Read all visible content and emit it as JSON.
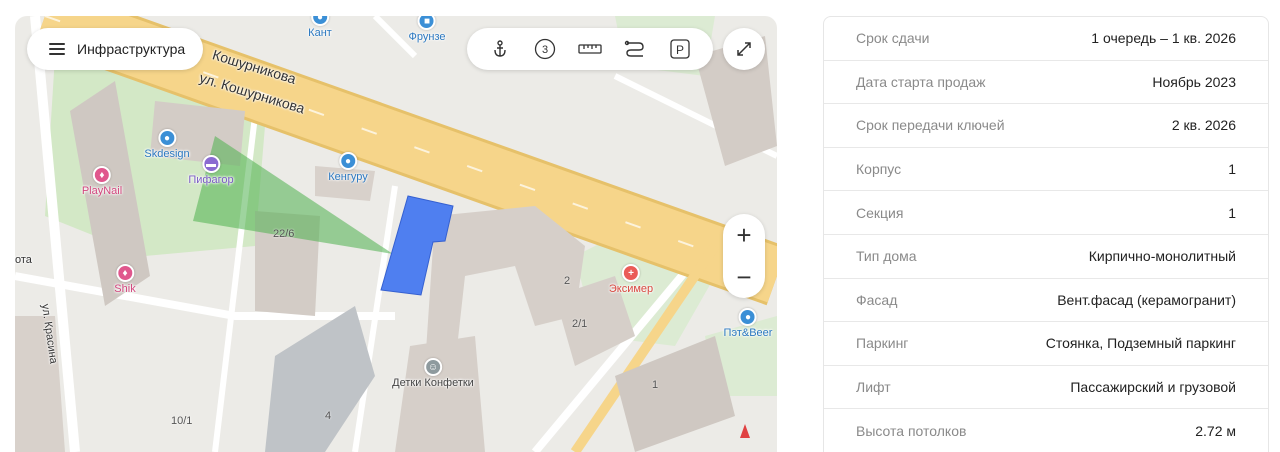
{
  "map": {
    "infra_label": "Инфраструктура",
    "streets": [
      "Кошурникова",
      "ул. Кошурникова",
      "ул. Красина",
      "ота"
    ],
    "pois": [
      {
        "name": "Кант",
        "kind": "blue"
      },
      {
        "name": "Фрунзе",
        "kind": "blue"
      },
      {
        "name": "Skdesign",
        "kind": "blue"
      },
      {
        "name": "Пифагор",
        "kind": "purple"
      },
      {
        "name": "PlayNail",
        "kind": "pink"
      },
      {
        "name": "Кенгуру",
        "kind": "blue"
      },
      {
        "name": "Shik",
        "kind": "pink"
      },
      {
        "name": "Эксимер",
        "kind": "red"
      },
      {
        "name": "Пэт&Beer",
        "kind": "blue"
      },
      {
        "name": "Детки Конфетки",
        "kind": "gray"
      }
    ],
    "house_numbers": [
      "22/6",
      "2",
      "2/1",
      "1",
      "4",
      "10/1"
    ],
    "layer_buttons": [
      "anchor-icon",
      "three-icon",
      "ruler-icon",
      "route-icon",
      "parking-icon"
    ],
    "layer_three_text": "3",
    "layer_parking_text": "P",
    "zoom_in": "+",
    "zoom_out": "−",
    "colors": {
      "highlight": "#4f7ff0",
      "view_cone": "#4fb04f",
      "road": "#f4cc72"
    }
  },
  "specs": {
    "rows": [
      {
        "key": "Срок сдачи",
        "value": "1 очередь – 1 кв. 2026"
      },
      {
        "key": "Дата старта продаж",
        "value": "Ноябрь 2023"
      },
      {
        "key": "Срок передачи ключей",
        "value": "2 кв. 2026"
      },
      {
        "key": "Корпус",
        "value": "1"
      },
      {
        "key": "Секция",
        "value": "1"
      },
      {
        "key": "Тип дома",
        "value": "Кирпично-монолитный"
      },
      {
        "key": "Фасад",
        "value": "Вент.фасад (керамогранит)"
      },
      {
        "key": "Паркинг",
        "value": "Стоянка, Подземный паркинг"
      },
      {
        "key": "Лифт",
        "value": "Пассажирский и грузовой"
      },
      {
        "key": "Высота потолков",
        "value": "2.72 м"
      }
    ]
  }
}
